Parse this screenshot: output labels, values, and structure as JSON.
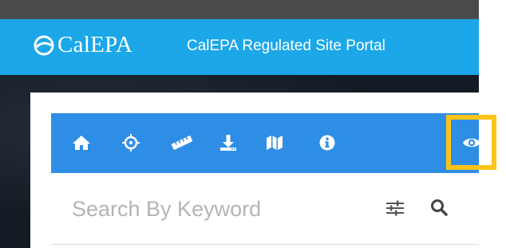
{
  "header": {
    "logo_text": "CalEPA",
    "portal_title": "CalEPA Regulated Site Portal"
  },
  "toolbar": {
    "icons": [
      "home-icon",
      "crosshairs-icon",
      "ruler-icon",
      "download-icon",
      "map-icon",
      "info-icon",
      "eye-icon"
    ]
  },
  "search": {
    "placeholder": "Search By Keyword",
    "value": ""
  },
  "colors": {
    "header_bg": "#1ba7e8",
    "toolbar_bg": "#2e8ee6",
    "highlight": "#fcc419",
    "top_strip": "#4a4a4a",
    "background_dark": "#141b24"
  }
}
